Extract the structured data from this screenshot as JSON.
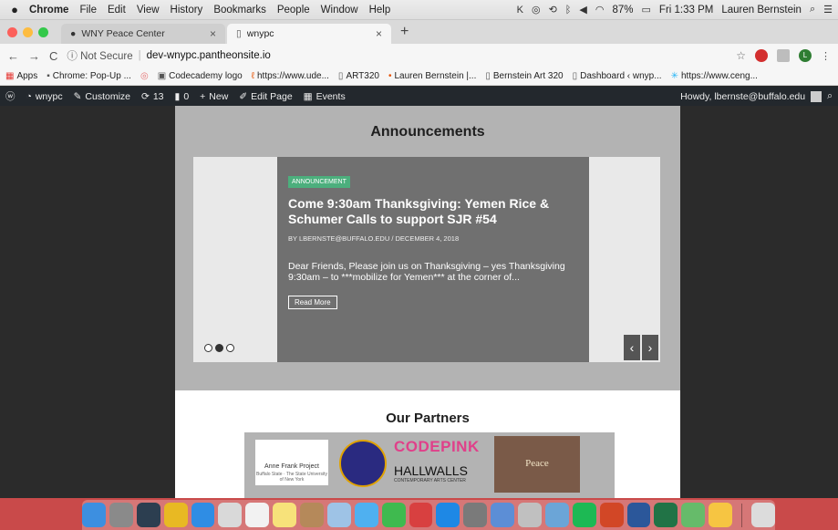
{
  "menubar": {
    "apple": "",
    "app_name": "Chrome",
    "items": [
      "File",
      "Edit",
      "View",
      "History",
      "Bookmarks",
      "People",
      "Window",
      "Help"
    ],
    "battery": "87%",
    "clock": "Fri 1:33 PM",
    "user": "Lauren Bernstein"
  },
  "tabs": [
    {
      "label": "WNY Peace Center",
      "close": "×"
    },
    {
      "label": "wnypc",
      "close": "×"
    }
  ],
  "new_tab": "+",
  "address": {
    "back": "←",
    "forward": "→",
    "reload": "C",
    "security": "ⓘ Not Secure",
    "separator": "|",
    "url": "dev-wnypc.pantheonsite.io"
  },
  "profile_initial": "L",
  "bookmarks": [
    {
      "label": "Apps",
      "icon": "apps-grid-icon",
      "glyph": "▦"
    },
    {
      "label": "Chrome: Pop-Up ...",
      "icon": "page-icon",
      "glyph": "▪"
    },
    {
      "label": "",
      "icon": "page-icon",
      "glyph": "◎"
    },
    {
      "label": "Codecademy logo",
      "icon": "codecademy-icon",
      "glyph": "▣"
    },
    {
      "label": "https://www.ude...",
      "icon": "udemy-icon",
      "glyph": "ℓ"
    },
    {
      "label": "ART320",
      "icon": "page-icon",
      "glyph": "▯"
    },
    {
      "label": "Lauren Bernstein |...",
      "icon": "portfolio-icon",
      "glyph": "•"
    },
    {
      "label": "Bernstein Art 320",
      "icon": "page-icon",
      "glyph": "▯"
    },
    {
      "label": "Dashboard ‹ wnyp...",
      "icon": "page-icon",
      "glyph": "▯"
    },
    {
      "label": "https://www.ceng...",
      "icon": "spark-icon",
      "glyph": "✳"
    }
  ],
  "wpbar": {
    "site": "wnypc",
    "customize": "Customize",
    "updates": "13",
    "comments": "0",
    "new": "New",
    "edit_page": "Edit Page",
    "events": "Events",
    "howdy": "Howdy, lbernste@buffalo.edu"
  },
  "announcements": {
    "heading": "Announcements",
    "badge": "ANNOUNCEMENT",
    "title": "Come 9:30am Thanksgiving: Yemen Rice & Schumer Calls to support SJR #54",
    "byline": "BY LBERNSTE@BUFFALO.EDU / DECEMBER 4, 2018",
    "excerpt": "Dear Friends, Please join us on Thanksgiving – yes Thanksgiving 9:30am – to ***mobilize for Yemen*** at the corner of...",
    "read_more": "Read More",
    "prev": "‹",
    "next": "›"
  },
  "partners": {
    "heading": "Our Partners",
    "annefrank": "Anne Frank Project",
    "annefrank_sub": "Buffalo State · The State University of New York",
    "codepink": "CODEPINK",
    "hallwalls": "HALLWALLS",
    "hallwalls_sub": "CONTEMPORARY ARTS CENTER",
    "peace": "Peace"
  },
  "colors": {
    "menubar": "#ececec",
    "wpbar": "#23282d",
    "announce_bg": "#b3b3b3",
    "card": "#707070",
    "badge": "#4caf7d",
    "dock": "#c94a4a"
  },
  "dock_icons": [
    {
      "name": "finder-icon",
      "color": "#3d8fe0"
    },
    {
      "name": "launchpad-icon",
      "color": "#8a8a8a"
    },
    {
      "name": "mission-control-icon",
      "color": "#2c3e50"
    },
    {
      "name": "chrome-icon",
      "color": "#e8b923"
    },
    {
      "name": "safari-icon",
      "color": "#2f8de4"
    },
    {
      "name": "photos-icon",
      "color": "#d9d9d9"
    },
    {
      "name": "calendar-icon",
      "color": "#f2f2f2"
    },
    {
      "name": "notes-icon",
      "color": "#f7e27a"
    },
    {
      "name": "contacts-icon",
      "color": "#b5895a"
    },
    {
      "name": "preview-icon",
      "color": "#9ec3e6"
    },
    {
      "name": "messages-icon",
      "color": "#4fb0f0"
    },
    {
      "name": "facetime-icon",
      "color": "#3fba4f"
    },
    {
      "name": "photo-booth-icon",
      "color": "#d84040"
    },
    {
      "name": "app-store-icon",
      "color": "#1e88e5"
    },
    {
      "name": "system-prefs-icon",
      "color": "#7a7a7a"
    },
    {
      "name": "siri-icon",
      "color": "#5c8ed6"
    },
    {
      "name": "help-icon",
      "color": "#c0c0c0"
    },
    {
      "name": "image-capture-icon",
      "color": "#6ba5d7"
    },
    {
      "name": "spotify-icon",
      "color": "#1db954"
    },
    {
      "name": "powerpoint-icon",
      "color": "#d24726"
    },
    {
      "name": "word-icon",
      "color": "#2b579a"
    },
    {
      "name": "excel-icon",
      "color": "#217346"
    },
    {
      "name": "atom-icon",
      "color": "#66bb6a"
    },
    {
      "name": "cyberduck-icon",
      "color": "#f6c542"
    }
  ],
  "dock_trash": {
    "name": "trash-icon",
    "color": "#dcdcdc"
  }
}
